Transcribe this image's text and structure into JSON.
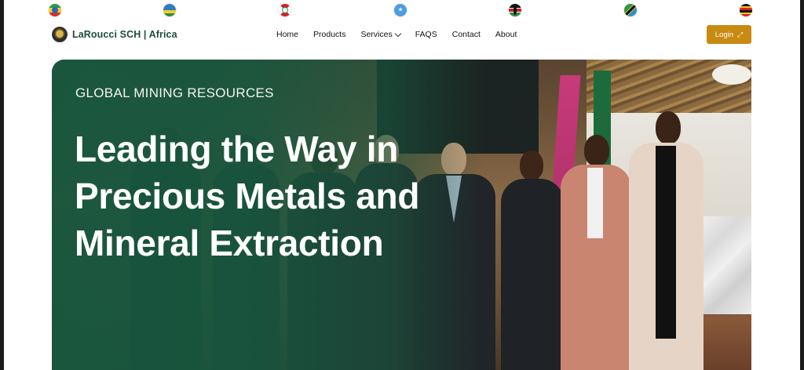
{
  "flags": [
    {
      "country": "Ethiopia",
      "icon": "flag-ethiopia-icon",
      "colors": [
        "#2b9a3f",
        "#f5d21c",
        "#d8321c"
      ]
    },
    {
      "country": "Rwanda",
      "icon": "flag-rwanda-icon",
      "colors": [
        "#2f7bc6",
        "#f0d21f",
        "#2a8d3d"
      ]
    },
    {
      "country": "Burundi",
      "icon": "flag-burundi-icon",
      "colors": [
        "#d41f2b",
        "#ffffff",
        "#2d9b3d"
      ]
    },
    {
      "country": "Somalia",
      "icon": "flag-somalia-icon",
      "colors": [
        "#4d9de0",
        "#4d9de0",
        "#4d9de0"
      ]
    },
    {
      "country": "Kenya",
      "icon": "flag-kenya-icon",
      "colors": [
        "#111111",
        "#c9211e",
        "#2d8a3a"
      ]
    },
    {
      "country": "Tanzania",
      "icon": "flag-tanzania-icon",
      "colors": [
        "#2e9b3f",
        "#111111",
        "#2e8fd0"
      ]
    },
    {
      "country": "Uganda",
      "icon": "flag-uganda-icon",
      "colors": [
        "#111111",
        "#f5c517",
        "#d8231c"
      ]
    }
  ],
  "brand": {
    "name": "LaRoucci SCH | Africa",
    "logo_icon": "crest-logo-icon",
    "color": "#1e4d3b"
  },
  "nav": {
    "items": [
      {
        "label": "Home"
      },
      {
        "label": "Products"
      },
      {
        "label": "Services",
        "has_dropdown": true
      },
      {
        "label": "FAQS"
      },
      {
        "label": "Contact"
      },
      {
        "label": "About"
      }
    ]
  },
  "login": {
    "label": "Login",
    "icon": "arrow-expand-icon",
    "color": "#c98a12"
  },
  "hero": {
    "eyebrow": "GLOBAL MINING RESOURCES",
    "headline": "Leading the Way in Precious Metals and Mineral Extraction",
    "overlay_color": "#18563e"
  }
}
